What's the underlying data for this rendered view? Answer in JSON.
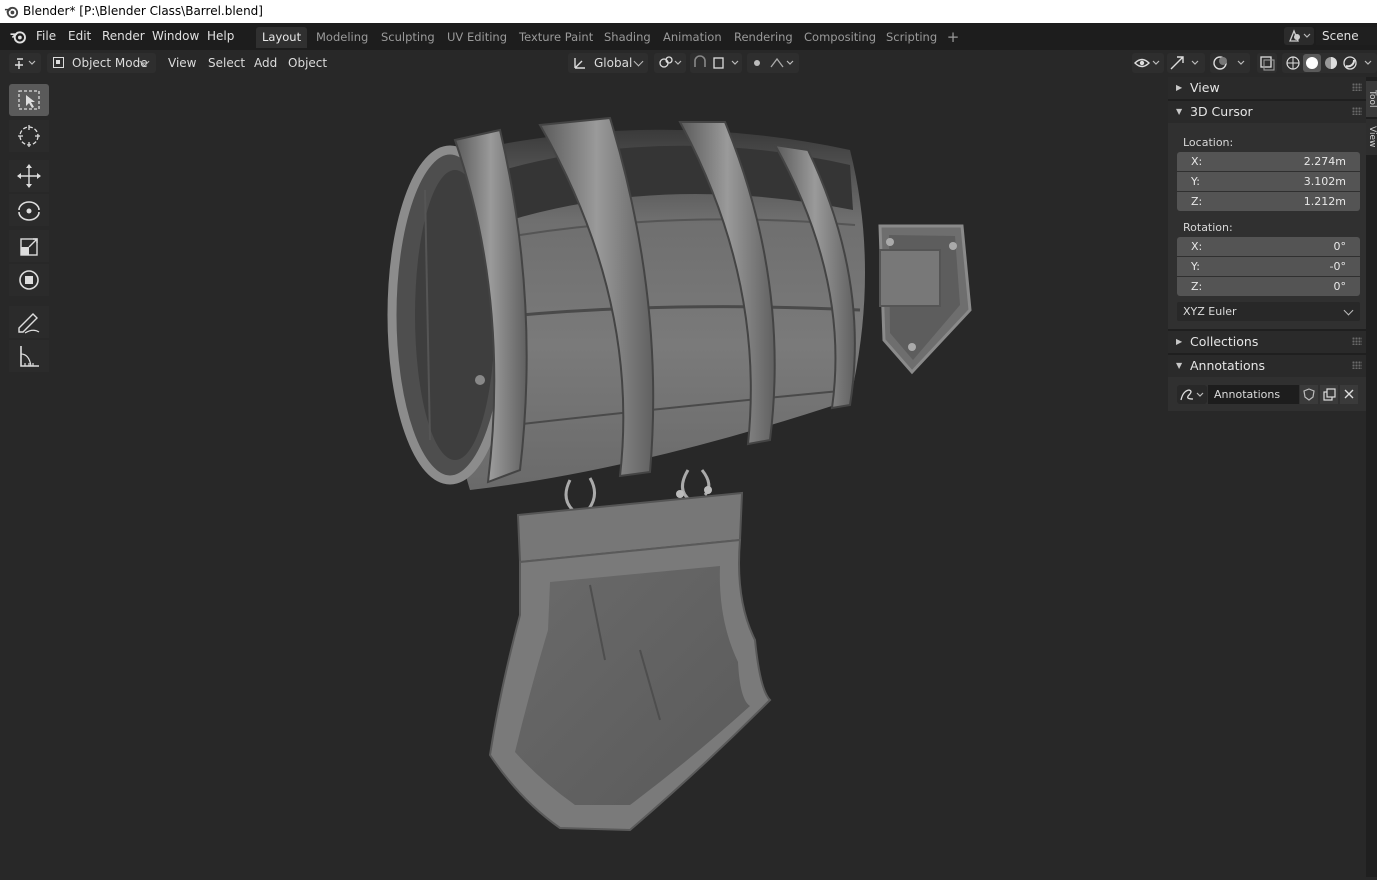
{
  "window": {
    "title": "Blender* [P:\\Blender Class\\Barrel.blend]"
  },
  "menu": {
    "items": [
      "File",
      "Edit",
      "Render",
      "Window",
      "Help"
    ]
  },
  "workspaces": {
    "tabs": [
      "Layout",
      "Modeling",
      "Sculpting",
      "UV Editing",
      "Texture Paint",
      "Shading",
      "Animation",
      "Rendering",
      "Compositing",
      "Scripting"
    ],
    "active": "Layout",
    "add_label": "+"
  },
  "scene": {
    "label": "Scene"
  },
  "header": {
    "mode": "Object Mode",
    "view": "View",
    "select": "Select",
    "add": "Add",
    "object": "Object",
    "orientation": "Global"
  },
  "npanel": {
    "view": {
      "label": "View",
      "expanded": false
    },
    "cursor": {
      "label": "3D Cursor",
      "expanded": true,
      "location_label": "Location:",
      "location": [
        {
          "axis": "X:",
          "value": "2.274m"
        },
        {
          "axis": "Y:",
          "value": "3.102m"
        },
        {
          "axis": "Z:",
          "value": "1.212m"
        }
      ],
      "rotation_label": "Rotation:",
      "rotation": [
        {
          "axis": "X:",
          "value": "0°"
        },
        {
          "axis": "Y:",
          "value": "-0°"
        },
        {
          "axis": "Z:",
          "value": "0°"
        }
      ],
      "rotation_mode": "XYZ Euler"
    },
    "collections": {
      "label": "Collections",
      "expanded": false
    },
    "annotations": {
      "label": "Annotations",
      "expanded": true,
      "layer_name": "Annotations"
    }
  },
  "side_tabs": [
    "Tool",
    "View"
  ],
  "colors": {
    "ui_dark": "#1d1d1d",
    "viewport_bg": "#282828",
    "panel": "#303030",
    "field": "#545454",
    "active_tool": "#5a5a5a"
  }
}
